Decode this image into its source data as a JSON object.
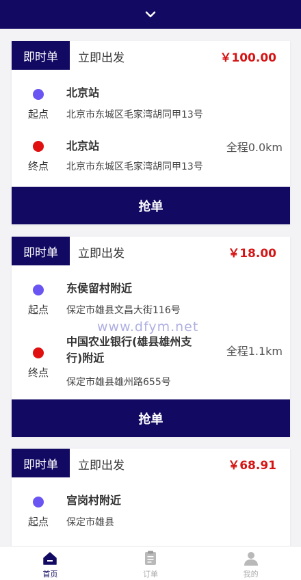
{
  "header": {
    "icon": "chevron-down-icon"
  },
  "orders": [
    {
      "tag": "即时单",
      "depart": "立即出发",
      "price": "￥100.00",
      "start": {
        "label": "起点",
        "name": "北京站",
        "address": "北京市东城区毛家湾胡同甲13号"
      },
      "end": {
        "label": "终点",
        "name": "北京站",
        "address": "北京市东城区毛家湾胡同甲13号",
        "distance": "全程0.0km"
      },
      "action": "抢单"
    },
    {
      "tag": "即时单",
      "depart": "立即出发",
      "price": "￥18.00",
      "start": {
        "label": "起点",
        "name": "东侯留村附近",
        "address": "保定市雄县文昌大街116号"
      },
      "end": {
        "label": "终点",
        "name": "中国农业银行(雄县雄州支行)附近",
        "name_line1": "中国农业银行(雄县雄州支",
        "name_line2": "行)附近",
        "address": "保定市雄县雄州路655号",
        "distance": "全程1.1km"
      },
      "action": "抢单"
    },
    {
      "tag": "即时单",
      "depart": "立即出发",
      "price": "￥68.91",
      "start": {
        "label": "起点",
        "name": "宫岗村附近",
        "address": "保定市雄县"
      }
    }
  ],
  "watermark": "www.dfym.net",
  "tabbar": {
    "items": [
      {
        "label": "首页",
        "icon": "home-icon",
        "active": true
      },
      {
        "label": "订单",
        "icon": "clipboard-icon",
        "active": false
      },
      {
        "label": "我的",
        "icon": "user-icon",
        "active": false
      }
    ]
  },
  "colors": {
    "primary": "#120a62",
    "price": "#d51515",
    "start_dot": "#6a55f3",
    "end_dot": "#e01010"
  }
}
